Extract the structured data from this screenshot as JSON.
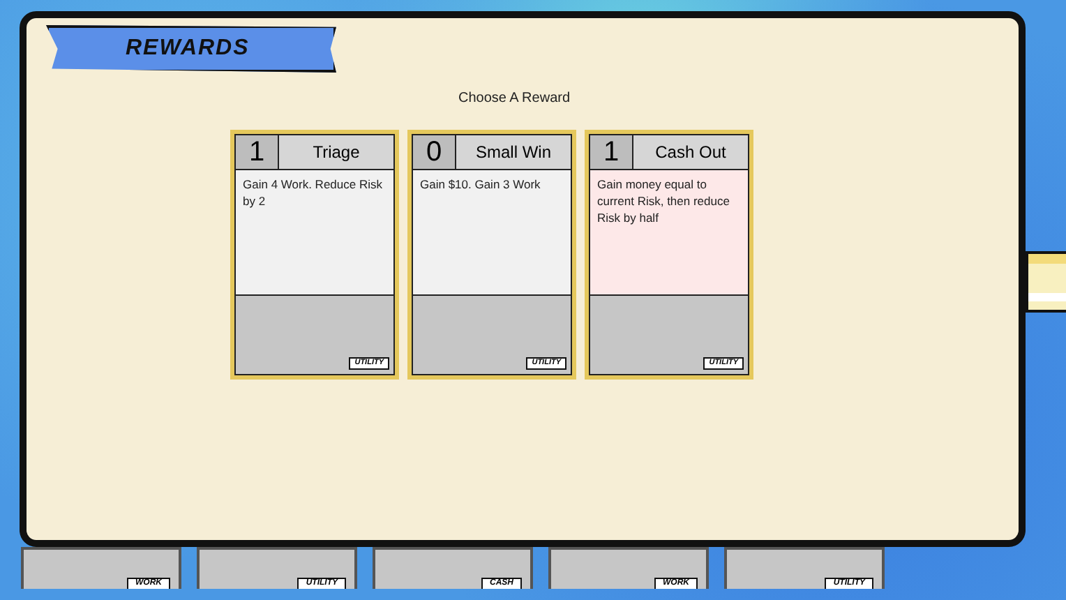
{
  "header": {
    "title": "REWARDS"
  },
  "prompt": "Choose A Reward",
  "rewards": [
    {
      "cost": "1",
      "name": "Triage",
      "description": "Gain 4 Work. Reduce Risk by 2",
      "tag": "UTILITY",
      "color": "#f1f1f1"
    },
    {
      "cost": "0",
      "name": "Small Win",
      "description": "Gain $10. Gain 3 Work",
      "tag": "UTILITY",
      "color": "#f1f1f1"
    },
    {
      "cost": "1",
      "name": "Cash Out",
      "description": "Gain money equal to current Risk, then reduce Risk by half",
      "tag": "UTILITY",
      "color": "#fde8e8"
    }
  ],
  "hand": [
    {
      "tag": "WORK"
    },
    {
      "tag": "UTILITY"
    },
    {
      "tag": "CASH"
    },
    {
      "tag": "WORK"
    },
    {
      "tag": "UTILITY"
    }
  ]
}
